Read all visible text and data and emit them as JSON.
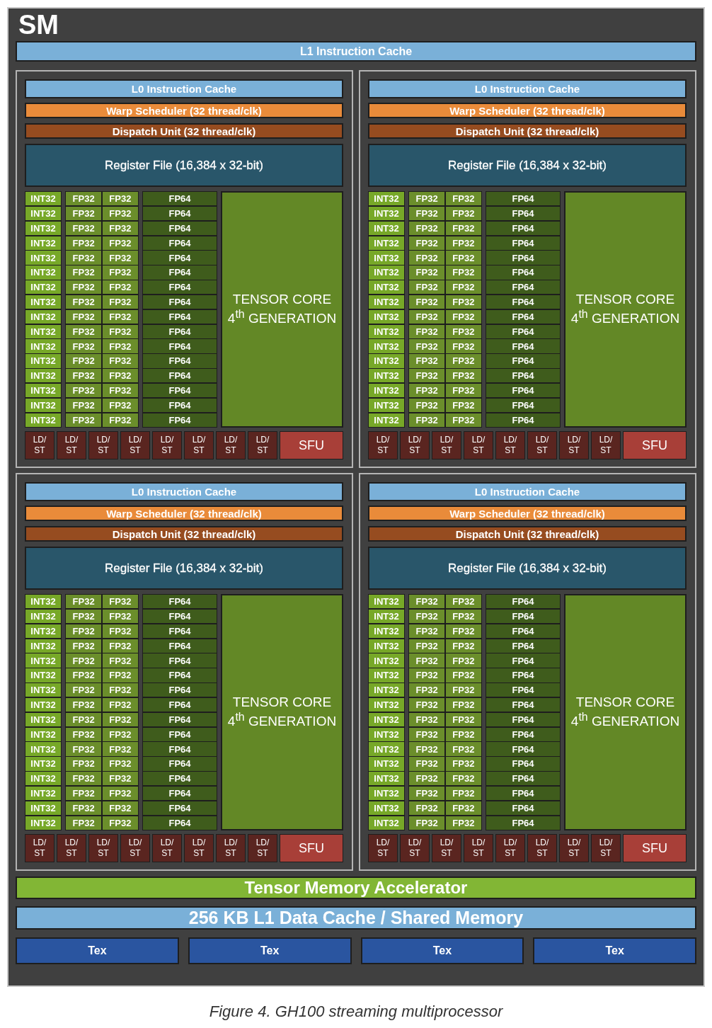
{
  "sm": {
    "title": "SM",
    "l1_instruction_cache": "L1 Instruction Cache",
    "partitions": [
      {
        "l0_cache": "L0 Instruction Cache",
        "warp_scheduler": "Warp Scheduler (32 thread/clk)",
        "dispatch_unit": "Dispatch Unit (32 thread/clk)",
        "register_file": "Register File (16,384 x 32-bit)",
        "rows": [
          {
            "int32": "INT32",
            "fp32": [
              "FP32",
              "FP32"
            ],
            "fp64": "FP64"
          },
          {
            "int32": "INT32",
            "fp32": [
              "FP32",
              "FP32"
            ],
            "fp64": "FP64"
          },
          {
            "int32": "INT32",
            "fp32": [
              "FP32",
              "FP32"
            ],
            "fp64": "FP64"
          },
          {
            "int32": "INT32",
            "fp32": [
              "FP32",
              "FP32"
            ],
            "fp64": "FP64"
          },
          {
            "int32": "INT32",
            "fp32": [
              "FP32",
              "FP32"
            ],
            "fp64": "FP64"
          },
          {
            "int32": "INT32",
            "fp32": [
              "FP32",
              "FP32"
            ],
            "fp64": "FP64"
          },
          {
            "int32": "INT32",
            "fp32": [
              "FP32",
              "FP32"
            ],
            "fp64": "FP64"
          },
          {
            "int32": "INT32",
            "fp32": [
              "FP32",
              "FP32"
            ],
            "fp64": "FP64"
          },
          {
            "int32": "INT32",
            "fp32": [
              "FP32",
              "FP32"
            ],
            "fp64": "FP64"
          },
          {
            "int32": "INT32",
            "fp32": [
              "FP32",
              "FP32"
            ],
            "fp64": "FP64"
          },
          {
            "int32": "INT32",
            "fp32": [
              "FP32",
              "FP32"
            ],
            "fp64": "FP64"
          },
          {
            "int32": "INT32",
            "fp32": [
              "FP32",
              "FP32"
            ],
            "fp64": "FP64"
          },
          {
            "int32": "INT32",
            "fp32": [
              "FP32",
              "FP32"
            ],
            "fp64": "FP64"
          },
          {
            "int32": "INT32",
            "fp32": [
              "FP32",
              "FP32"
            ],
            "fp64": "FP64"
          },
          {
            "int32": "INT32",
            "fp32": [
              "FP32",
              "FP32"
            ],
            "fp64": "FP64"
          },
          {
            "int32": "INT32",
            "fp32": [
              "FP32",
              "FP32"
            ],
            "fp64": "FP64"
          }
        ],
        "tensor_core": "TENSOR CORE\n4$^{th}$ GENERATION",
        "ld_st": [
          "LD/\nST",
          "LD/\nST",
          "LD/\nST",
          "LD/\nST",
          "LD/\nST",
          "LD/\nST",
          "LD/\nST",
          "LD/\nST"
        ],
        "sfu": "SFU"
      },
      {
        "l0_cache": "L0 Instruction Cache",
        "warp_scheduler": "Warp Scheduler (32 thread/clk)",
        "dispatch_unit": "Dispatch Unit (32 thread/clk)",
        "register_file": "Register File (16,384 x 32-bit)",
        "rows": [
          {
            "int32": "INT32",
            "fp32": [
              "FP32",
              "FP32"
            ],
            "fp64": "FP64"
          },
          {
            "int32": "INT32",
            "fp32": [
              "FP32",
              "FP32"
            ],
            "fp64": "FP64"
          },
          {
            "int32": "INT32",
            "fp32": [
              "FP32",
              "FP32"
            ],
            "fp64": "FP64"
          },
          {
            "int32": "INT32",
            "fp32": [
              "FP32",
              "FP32"
            ],
            "fp64": "FP64"
          },
          {
            "int32": "INT32",
            "fp32": [
              "FP32",
              "FP32"
            ],
            "fp64": "FP64"
          },
          {
            "int32": "INT32",
            "fp32": [
              "FP32",
              "FP32"
            ],
            "fp64": "FP64"
          },
          {
            "int32": "INT32",
            "fp32": [
              "FP32",
              "FP32"
            ],
            "fp64": "FP64"
          },
          {
            "int32": "INT32",
            "fp32": [
              "FP32",
              "FP32"
            ],
            "fp64": "FP64"
          },
          {
            "int32": "INT32",
            "fp32": [
              "FP32",
              "FP32"
            ],
            "fp64": "FP64"
          },
          {
            "int32": "INT32",
            "fp32": [
              "FP32",
              "FP32"
            ],
            "fp64": "FP64"
          },
          {
            "int32": "INT32",
            "fp32": [
              "FP32",
              "FP32"
            ],
            "fp64": "FP64"
          },
          {
            "int32": "INT32",
            "fp32": [
              "FP32",
              "FP32"
            ],
            "fp64": "FP64"
          },
          {
            "int32": "INT32",
            "fp32": [
              "FP32",
              "FP32"
            ],
            "fp64": "FP64"
          },
          {
            "int32": "INT32",
            "fp32": [
              "FP32",
              "FP32"
            ],
            "fp64": "FP64"
          },
          {
            "int32": "INT32",
            "fp32": [
              "FP32",
              "FP32"
            ],
            "fp64": "FP64"
          },
          {
            "int32": "INT32",
            "fp32": [
              "FP32",
              "FP32"
            ],
            "fp64": "FP64"
          }
        ],
        "tensor_core": "TENSOR CORE\n4$^{th}$ GENERATION",
        "ld_st": [
          "LD/\nST",
          "LD/\nST",
          "LD/\nST",
          "LD/\nST",
          "LD/\nST",
          "LD/\nST",
          "LD/\nST",
          "LD/\nST"
        ],
        "sfu": "SFU"
      },
      {
        "l0_cache": "L0 Instruction Cache",
        "warp_scheduler": "Warp Scheduler (32 thread/clk)",
        "dispatch_unit": "Dispatch Unit (32 thread/clk)",
        "register_file": "Register File (16,384 x 32-bit)",
        "rows": [
          {
            "int32": "INT32",
            "fp32": [
              "FP32",
              "FP32"
            ],
            "fp64": "FP64"
          },
          {
            "int32": "INT32",
            "fp32": [
              "FP32",
              "FP32"
            ],
            "fp64": "FP64"
          },
          {
            "int32": "INT32",
            "fp32": [
              "FP32",
              "FP32"
            ],
            "fp64": "FP64"
          },
          {
            "int32": "INT32",
            "fp32": [
              "FP32",
              "FP32"
            ],
            "fp64": "FP64"
          },
          {
            "int32": "INT32",
            "fp32": [
              "FP32",
              "FP32"
            ],
            "fp64": "FP64"
          },
          {
            "int32": "INT32",
            "fp32": [
              "FP32",
              "FP32"
            ],
            "fp64": "FP64"
          },
          {
            "int32": "INT32",
            "fp32": [
              "FP32",
              "FP32"
            ],
            "fp64": "FP64"
          },
          {
            "int32": "INT32",
            "fp32": [
              "FP32",
              "FP32"
            ],
            "fp64": "FP64"
          },
          {
            "int32": "INT32",
            "fp32": [
              "FP32",
              "FP32"
            ],
            "fp64": "FP64"
          },
          {
            "int32": "INT32",
            "fp32": [
              "FP32",
              "FP32"
            ],
            "fp64": "FP64"
          },
          {
            "int32": "INT32",
            "fp32": [
              "FP32",
              "FP32"
            ],
            "fp64": "FP64"
          },
          {
            "int32": "INT32",
            "fp32": [
              "FP32",
              "FP32"
            ],
            "fp64": "FP64"
          },
          {
            "int32": "INT32",
            "fp32": [
              "FP32",
              "FP32"
            ],
            "fp64": "FP64"
          },
          {
            "int32": "INT32",
            "fp32": [
              "FP32",
              "FP32"
            ],
            "fp64": "FP64"
          },
          {
            "int32": "INT32",
            "fp32": [
              "FP32",
              "FP32"
            ],
            "fp64": "FP64"
          },
          {
            "int32": "INT32",
            "fp32": [
              "FP32",
              "FP32"
            ],
            "fp64": "FP64"
          }
        ],
        "tensor_core": "TENSOR CORE\n4$^{th}$ GENERATION",
        "ld_st": [
          "LD/\nST",
          "LD/\nST",
          "LD/\nST",
          "LD/\nST",
          "LD/\nST",
          "LD/\nST",
          "LD/\nST",
          "LD/\nST"
        ],
        "sfu": "SFU"
      },
      {
        "l0_cache": "L0 Instruction Cache",
        "warp_scheduler": "Warp Scheduler (32 thread/clk)",
        "dispatch_unit": "Dispatch Unit (32 thread/clk)",
        "register_file": "Register File (16,384 x 32-bit)",
        "rows": [
          {
            "int32": "INT32",
            "fp32": [
              "FP32",
              "FP32"
            ],
            "fp64": "FP64"
          },
          {
            "int32": "INT32",
            "fp32": [
              "FP32",
              "FP32"
            ],
            "fp64": "FP64"
          },
          {
            "int32": "INT32",
            "fp32": [
              "FP32",
              "FP32"
            ],
            "fp64": "FP64"
          },
          {
            "int32": "INT32",
            "fp32": [
              "FP32",
              "FP32"
            ],
            "fp64": "FP64"
          },
          {
            "int32": "INT32",
            "fp32": [
              "FP32",
              "FP32"
            ],
            "fp64": "FP64"
          },
          {
            "int32": "INT32",
            "fp32": [
              "FP32",
              "FP32"
            ],
            "fp64": "FP64"
          },
          {
            "int32": "INT32",
            "fp32": [
              "FP32",
              "FP32"
            ],
            "fp64": "FP64"
          },
          {
            "int32": "INT32",
            "fp32": [
              "FP32",
              "FP32"
            ],
            "fp64": "FP64"
          },
          {
            "int32": "INT32",
            "fp32": [
              "FP32",
              "FP32"
            ],
            "fp64": "FP64"
          },
          {
            "int32": "INT32",
            "fp32": [
              "FP32",
              "FP32"
            ],
            "fp64": "FP64"
          },
          {
            "int32": "INT32",
            "fp32": [
              "FP32",
              "FP32"
            ],
            "fp64": "FP64"
          },
          {
            "int32": "INT32",
            "fp32": [
              "FP32",
              "FP32"
            ],
            "fp64": "FP64"
          },
          {
            "int32": "INT32",
            "fp32": [
              "FP32",
              "FP32"
            ],
            "fp64": "FP64"
          },
          {
            "int32": "INT32",
            "fp32": [
              "FP32",
              "FP32"
            ],
            "fp64": "FP64"
          },
          {
            "int32": "INT32",
            "fp32": [
              "FP32",
              "FP32"
            ],
            "fp64": "FP64"
          },
          {
            "int32": "INT32",
            "fp32": [
              "FP32",
              "FP32"
            ],
            "fp64": "FP64"
          }
        ],
        "tensor_core": "TENSOR CORE\n4$^{th}$ GENERATION",
        "ld_st": [
          "LD/\nST",
          "LD/\nST",
          "LD/\nST",
          "LD/\nST",
          "LD/\nST",
          "LD/\nST",
          "LD/\nST",
          "LD/\nST"
        ],
        "sfu": "SFU"
      }
    ],
    "tensor_memory_accelerator": "Tensor Memory Accelerator",
    "l1_data_cache": "256 KB L1 Data Cache / Shared Memory",
    "tex_units": [
      "Tex",
      "Tex",
      "Tex",
      "Tex"
    ]
  },
  "caption": "Figure 4. GH100 streaming multiprocessor"
}
